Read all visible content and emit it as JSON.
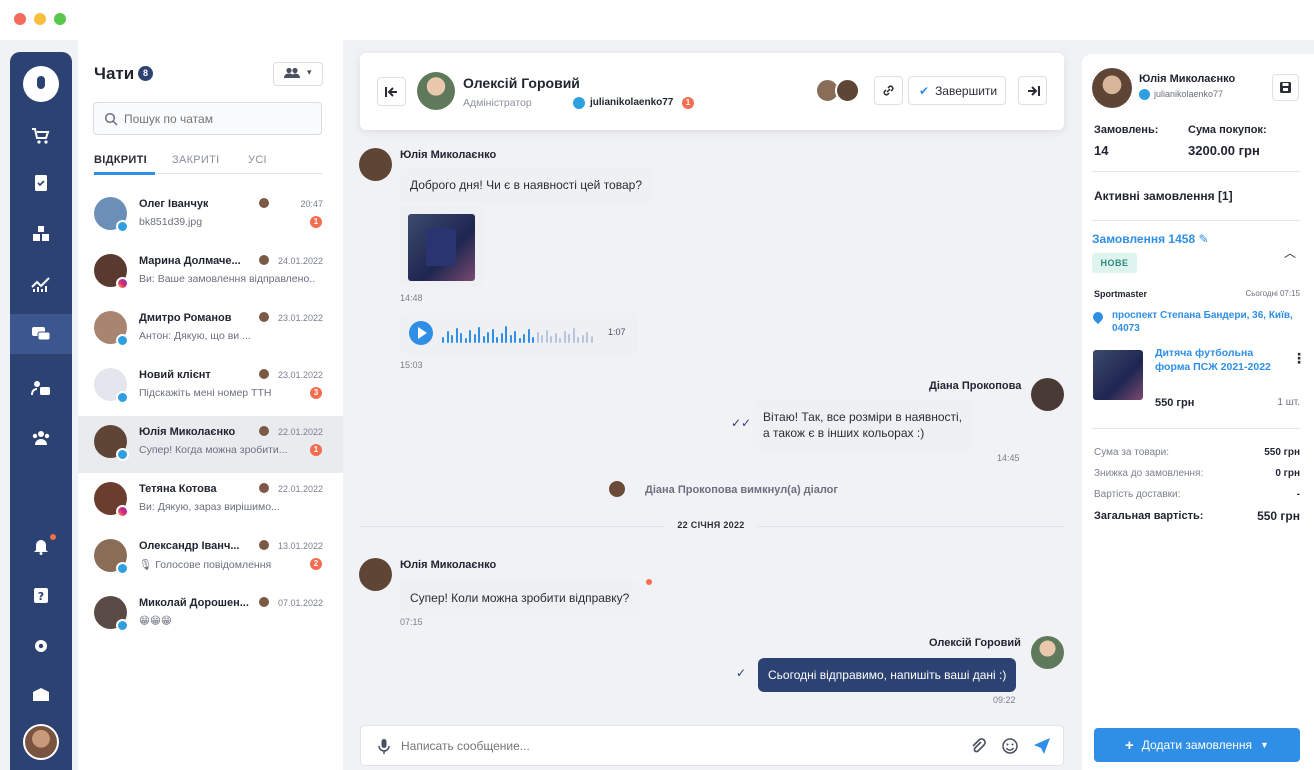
{
  "window": {
    "controls": [
      "close",
      "minimize",
      "maximize"
    ]
  },
  "nav": {
    "items": [
      {
        "icon": "cart-icon"
      },
      {
        "icon": "clipboard-icon"
      },
      {
        "icon": "boxes-icon"
      },
      {
        "icon": "analytics-icon"
      },
      {
        "icon": "chat-icon",
        "active": true
      },
      {
        "icon": "support-icon"
      },
      {
        "icon": "users-icon"
      },
      {
        "icon": "bell-icon"
      },
      {
        "icon": "help-icon"
      },
      {
        "icon": "settings-icon"
      },
      {
        "icon": "box-icon"
      }
    ]
  },
  "chat_list": {
    "title": "Чати",
    "count": "8",
    "search_placeholder": "Пошук по чатам",
    "tabs": [
      "ВІДКРИТІ",
      "ЗАКРИТІ",
      "УСІ"
    ],
    "active_tab": 0,
    "items": [
      {
        "name": "Олег Іванчук",
        "time": "20:47",
        "preview": "bk851d39.jpg",
        "unread": "1",
        "channel": "telegram",
        "avatar_color": "#6c8fb8"
      },
      {
        "name": "Марина Долмаче...",
        "time": "24.01.2022",
        "preview": "Ви: Ваше замовлення відправлено..",
        "unread": "",
        "channel": "instagram",
        "avatar_color": "#5a3a2e"
      },
      {
        "name": "Дмитро Романов",
        "time": "23.01.2022",
        "preview": "Антон: Дякую, що ви ...",
        "unread": "",
        "channel": "telegram",
        "avatar_color": "#a88570"
      },
      {
        "name": "Новий клієнт",
        "time": "23.01.2022",
        "preview": "Підскажіть мені номер ТТН",
        "unread": "3",
        "channel": "telegram",
        "avatar_color": "#e3e6ec"
      },
      {
        "name": "Юлія Миколаєнко",
        "time": "22.01.2022",
        "preview": "Супер! Когда можна зробити...",
        "unread": "1",
        "channel": "telegram",
        "avatar_color": "#5e4536",
        "active": true
      },
      {
        "name": "Тетяна Котова",
        "time": "22.01.2022",
        "preview": "Ви: Дякую, зараз вирішимо...",
        "unread": "",
        "channel": "instagram",
        "avatar_color": "#6b3d2e"
      },
      {
        "name": "Олександр Іванч...",
        "time": "13.01.2022",
        "preview": "🎙 Голосове повідомлення",
        "unread": "2",
        "channel": "telegram",
        "avatar_color": "#8a6d57"
      },
      {
        "name": "Миколай Дорошен...",
        "time": "07.01.2022",
        "preview": "😁😁😁",
        "unread": "",
        "channel": "telegram",
        "avatar_color": "#5a4a45"
      }
    ]
  },
  "header": {
    "name": "Олексій Горовий",
    "role": "Адміністратор",
    "handle": "julianikolaenko77",
    "unread": "1",
    "finish_label": "Завершити"
  },
  "messages": {
    "m1_sender": "Юлія Миколаєнко",
    "m1_text": "Доброго дня! Чи є в наявності цей товар?",
    "m1_time": "14:48",
    "voice_duration": "1:07",
    "voice_time": "15:03",
    "m2_sender": "Діана Прокопова",
    "m2_text": "Вітаю! Так, все розміри в наявності, а також є в інших кольорах :)",
    "m2_time": "14:45",
    "system": "Діана Прокопова вимкнул(а) діалог",
    "date_divider": "22 СІЧНЯ 2022",
    "m3_sender": "Юлія Миколаєнко",
    "m3_text": "Супер! Коли можна зробити відправку?",
    "m3_time": "07:15",
    "m4_sender": "Олексій Горовий",
    "m4_text": "Сьогодні відправимо, напишіть ваші дані :)",
    "m4_time": "09:22"
  },
  "composer": {
    "placeholder": "Написать сообщение..."
  },
  "profile": {
    "name": "Юлія Миколаєнко",
    "handle": "julianikolaenko77",
    "orders_label": "Замовлень:",
    "orders_value": "14",
    "spent_label": "Сума покупок:",
    "spent_value": "3200.00 грн",
    "active_orders": "Активні замовлення [1]",
    "order_title": "Замовлення 1458",
    "order_status": "НОВЕ",
    "store": "Sportmaster",
    "store_time": "Сьогодні 07:15",
    "address": "проспект Степана Бандери, 36, Київ, 04073",
    "product_name": "Дитяча футбольна форма ПСЖ  2021-2022",
    "product_price": "550 грн",
    "product_qty": "1 шт.",
    "sum_label": "Сума за товари:",
    "sum_value": "550 грн",
    "discount_label": "Знижка до замовлення:",
    "discount_value": "0 грн",
    "delivery_label": "Вартість доставки:",
    "delivery_value": "-",
    "total_label": "Загальная вартість:",
    "total_value": "550 грн",
    "add_order": "Додати замовлення"
  },
  "colors": {
    "nav": "#2c4273",
    "accent": "#2f8fe6",
    "unread": "#f36d4f"
  }
}
